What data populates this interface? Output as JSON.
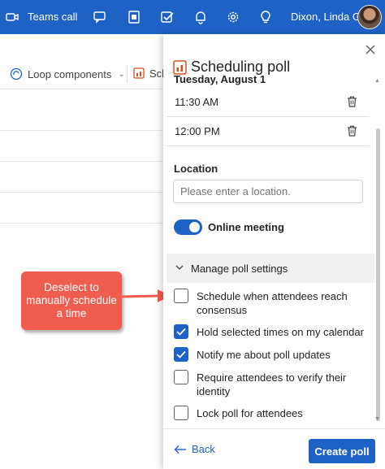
{
  "topbar": {
    "title": "Teams call",
    "user_name": "Dixon, Linda G",
    "icons": [
      "video-camera-icon",
      "chat-icon",
      "office-icon",
      "tasks-icon",
      "bell-icon",
      "gear-icon",
      "lightbulb-icon"
    ]
  },
  "background": {
    "loop_label": "Loop components",
    "scheduling_fragment": "Sch"
  },
  "callout": {
    "text": "Deselect to manually schedule a time"
  },
  "panel": {
    "title": "Scheduling poll",
    "date": "Tuesday, August 1",
    "times": [
      {
        "label": "11:30 AM"
      },
      {
        "label": "12:00 PM"
      }
    ],
    "location_label": "Location",
    "location_placeholder": "Please enter a location.",
    "online_meeting_label": "Online meeting",
    "online_meeting_on": true,
    "manage_label": "Manage poll settings",
    "settings": [
      {
        "label": "Schedule when attendees reach consensus",
        "checked": false
      },
      {
        "label": "Hold selected times on my calendar",
        "checked": true
      },
      {
        "label": "Notify me about poll updates",
        "checked": true
      },
      {
        "label": "Require attendees to verify their identity",
        "checked": false
      },
      {
        "label": "Lock poll for attendees",
        "checked": false
      }
    ],
    "back_label": "Back",
    "create_label": "Create poll"
  },
  "colors": {
    "brand_blue": "#1f62c6",
    "callout_red": "#f05d4f"
  }
}
